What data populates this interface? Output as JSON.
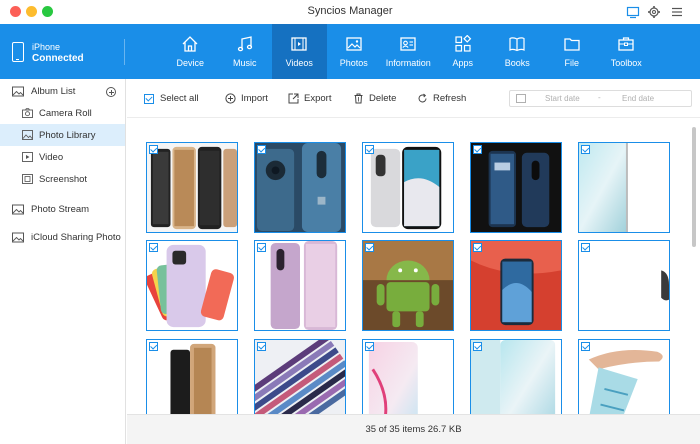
{
  "window": {
    "title": "Syncios Manager"
  },
  "device": {
    "name": "iPhone",
    "status": "Connected"
  },
  "nav": [
    {
      "label": "Device",
      "icon": "home-icon"
    },
    {
      "label": "Music",
      "icon": "music-note-icon"
    },
    {
      "label": "Videos",
      "icon": "film-icon",
      "active": true
    },
    {
      "label": "Photos",
      "icon": "image-icon"
    },
    {
      "label": "Information",
      "icon": "contact-card-icon"
    },
    {
      "label": "Apps",
      "icon": "apps-grid-icon"
    },
    {
      "label": "Books",
      "icon": "book-icon"
    },
    {
      "label": "File",
      "icon": "folder-icon"
    },
    {
      "label": "Toolbox",
      "icon": "toolbox-icon"
    }
  ],
  "sidebar": {
    "album_list": "Album List",
    "items": [
      {
        "label": "Camera Roll",
        "icon": "camera-icon"
      },
      {
        "label": "Photo Library",
        "icon": "photo-icon",
        "active": true
      },
      {
        "label": "Video",
        "icon": "video-play-icon"
      },
      {
        "label": "Screenshot",
        "icon": "screenshot-icon"
      }
    ],
    "photo_stream": "Photo Stream",
    "icloud": "iCloud Sharing Photo"
  },
  "toolbar": {
    "select_all": "Select all",
    "import": "Import",
    "export": "Export",
    "delete": "Delete",
    "refresh": "Refresh",
    "start_date_placeholder": "Start date",
    "end_date_placeholder": "End date",
    "date_separator": "-"
  },
  "status": {
    "summary": "35 of 35 items 26.7 KB"
  },
  "colors": {
    "accent": "#1a8ee8",
    "active_tab": "#1571c1",
    "sidebar_active": "#dceefc"
  }
}
